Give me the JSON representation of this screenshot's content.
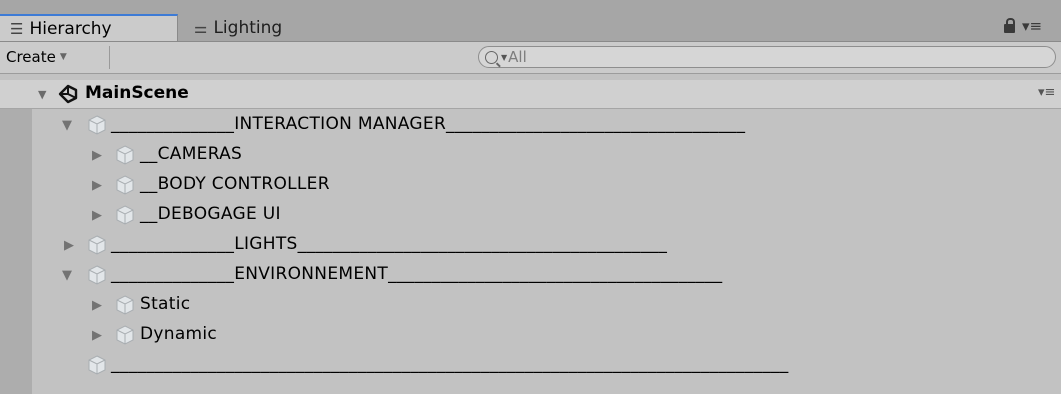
{
  "tabs": [
    {
      "label": "Hierarchy",
      "icon": "hierarchy-list-icon"
    },
    {
      "label": "Lighting",
      "icon": "lighting-icon"
    }
  ],
  "toolbar": {
    "create_label": "Create",
    "search_value": "All"
  },
  "scene": {
    "name": "MainScene"
  },
  "tree": [
    {
      "label": "______________INTERACTION MANAGER__________________________________",
      "expanded": true
    },
    {
      "label": "__CAMERAS",
      "expanded": false
    },
    {
      "label": "__BODY CONTROLLER",
      "expanded": false
    },
    {
      "label": "__DEBOGAGE UI",
      "expanded": false
    },
    {
      "label": "______________LIGHTS__________________________________________",
      "expanded": false
    },
    {
      "label": "______________ENVIRONNEMENT______________________________________",
      "expanded": true
    },
    {
      "label": "Static",
      "expanded": false
    },
    {
      "label": "Dynamic",
      "expanded": false
    },
    {
      "label": "_____________________________________________________________________________",
      "expanded": null
    }
  ],
  "colors": {
    "background": "#c2c2c2",
    "tab_accent": "#3d7bd6",
    "cube_icon": "#d9dde0"
  }
}
